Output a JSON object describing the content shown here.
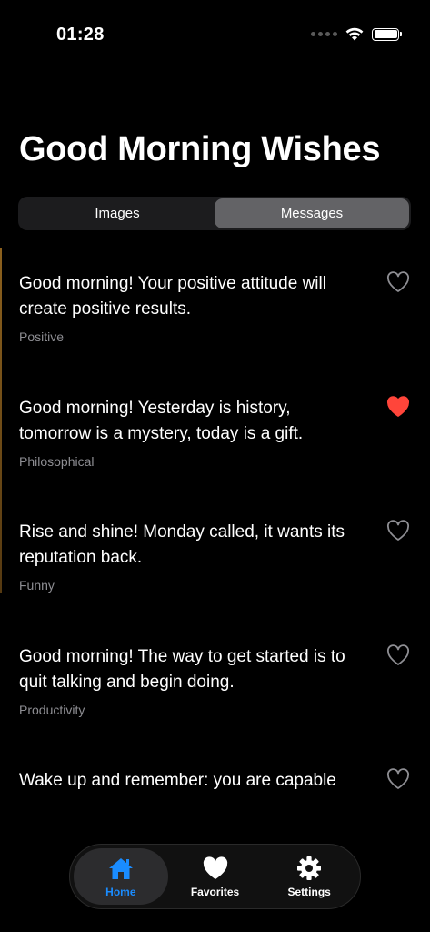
{
  "status_bar": {
    "time": "01:28"
  },
  "header": {
    "title": "Good Morning Wishes"
  },
  "segments": [
    {
      "label": "Images",
      "active": false
    },
    {
      "label": "Messages",
      "active": true
    }
  ],
  "messages": [
    {
      "text": "Good morning! Your positive attitude will create positive results.",
      "category": "Positive",
      "favorited": false
    },
    {
      "text": "Good morning! Yesterday is history, tomorrow is a mystery, today is a gift.",
      "category": "Philosophical",
      "favorited": true
    },
    {
      "text": "Rise and shine! Monday called, it wants its reputation back.",
      "category": "Funny",
      "favorited": false
    },
    {
      "text": "Good morning! The way to get started is to quit talking and begin doing.",
      "category": "Productivity",
      "favorited": false
    },
    {
      "text": "Wake up and remember: you are capable",
      "category": "",
      "favorited": false
    }
  ],
  "tab_bar": {
    "tabs": [
      {
        "label": "Home",
        "icon": "house-icon",
        "active": true
      },
      {
        "label": "Favorites",
        "icon": "heart-icon",
        "active": false
      },
      {
        "label": "Settings",
        "icon": "gear-icon",
        "active": false
      }
    ]
  },
  "colors": {
    "accent": "#1a8cff",
    "favorite": "#ff453a",
    "secondary_text": "#8e8e93"
  }
}
